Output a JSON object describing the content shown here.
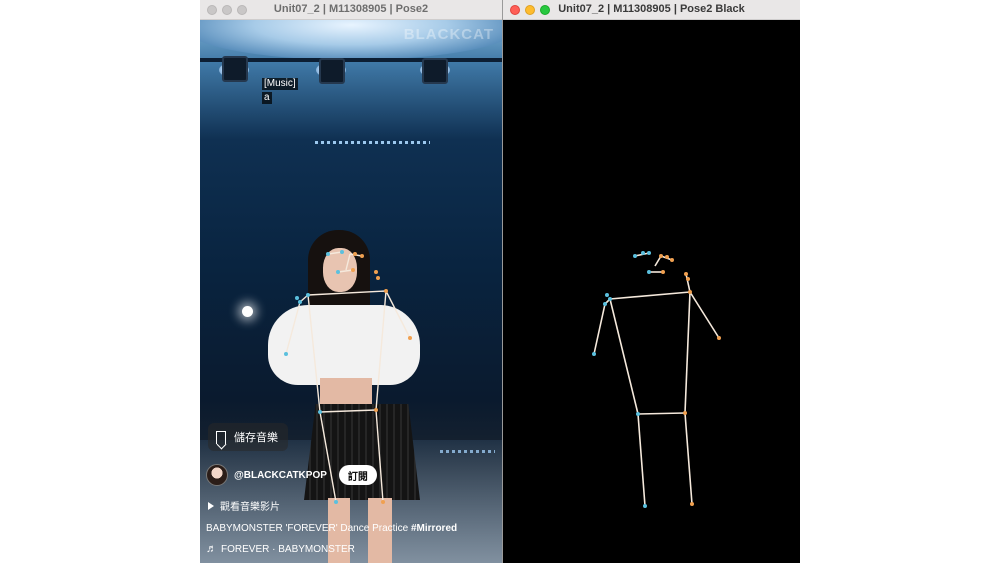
{
  "left_window": {
    "title": "Unit07_2 | M11308905 | Pose2",
    "video": {
      "watermark": "BLACKCAT",
      "caption_lines": [
        "[Music]",
        "a"
      ],
      "save_label": "儲存音樂",
      "channel_handle": "@BLACKCATKPOP",
      "subscribe_label": "訂閱",
      "watch_label": "觀看音樂影片",
      "title_prefix": "BABYMONSTER 'FOREVER' Dance Practice ",
      "title_tag": "#Mirrored",
      "music": "FOREVER · BABYMONSTER"
    }
  },
  "right_window": {
    "title": "Unit07_2 | M11308905 | Pose2 Black"
  },
  "colors": {
    "left_side_keypoints": "#5bc0de",
    "right_side_keypoints": "#f0a050",
    "skeleton_lines": "#f5e9dc",
    "canvas_background": "#000000"
  },
  "icons": {
    "save": "bookmark-icon",
    "watch": "play-icon",
    "music": "music-note-icon"
  }
}
